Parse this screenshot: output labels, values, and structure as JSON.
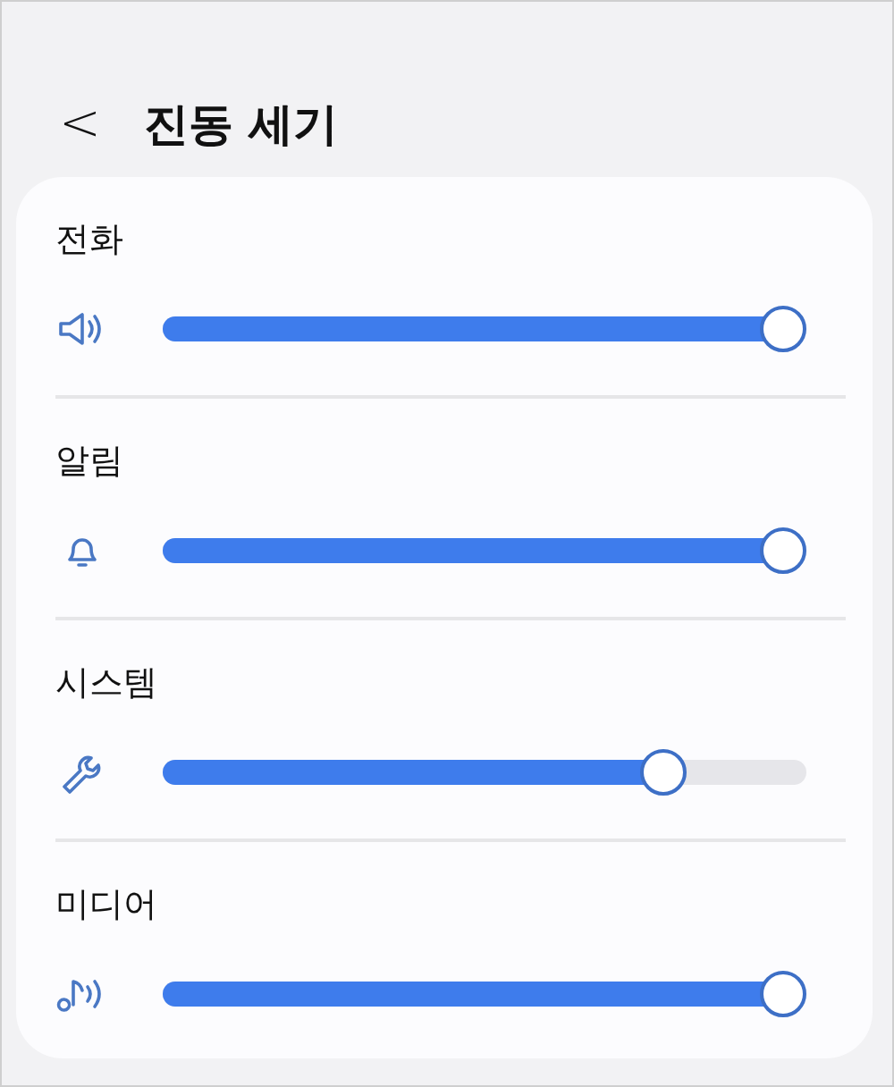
{
  "header": {
    "back": "<",
    "title": "진동 세기"
  },
  "channels": [
    {
      "name": "전화",
      "level": 1
    },
    {
      "name": "알림",
      "level": 1
    },
    {
      "name": "시스템",
      "level": 0.8
    },
    {
      "name": "미디어",
      "level": 1
    }
  ]
}
